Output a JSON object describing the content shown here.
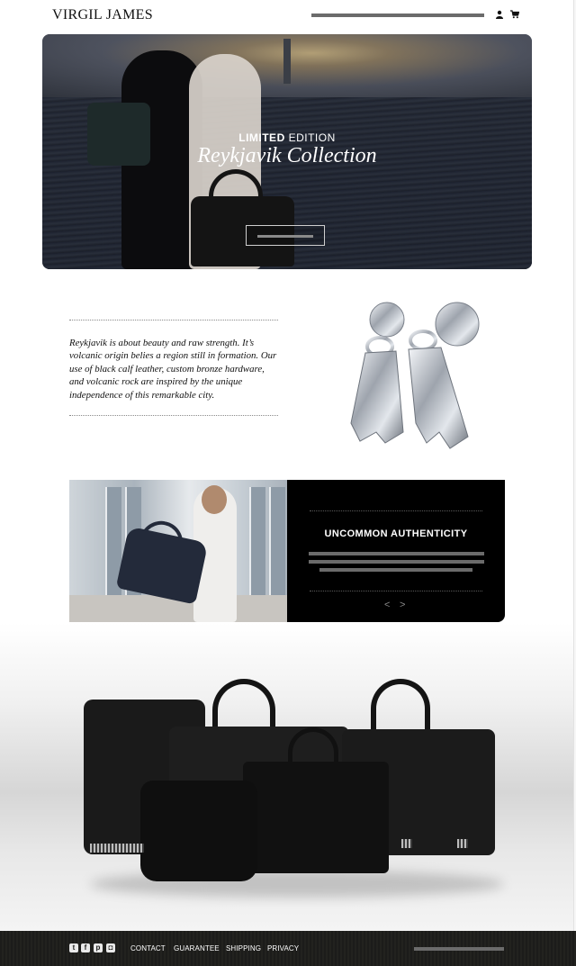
{
  "header": {
    "logo": "VIRGIL JAMES",
    "user_icon": "user-icon",
    "cart_icon": "cart-icon"
  },
  "hero": {
    "eyebrow_bold": "LIMITED",
    "eyebrow_light": "EDITION",
    "title": "Reykjavik Collection"
  },
  "story": {
    "text": "Reykjavik is about beauty and raw strength. It’s volcanic origin belies a region still in formation. Our use of black calf leather, custom bronze hardware, and volcanic rock are inspired by the unique independence of this remarkable city."
  },
  "feature": {
    "title": "UNCOMMON AUTHENTICITY",
    "prev": "<",
    "next": ">"
  },
  "footer": {
    "social": [
      "twitter-icon",
      "facebook-icon",
      "pinterest-icon",
      "instagram-icon"
    ],
    "links": [
      "CONTACT",
      "GUARANTEE",
      "SHIPPING",
      "PRIVACY"
    ]
  },
  "colors": {
    "accent_gray": "#6b6b6b",
    "panel_black": "#000000",
    "footer_bg": "#1c1c1a"
  }
}
